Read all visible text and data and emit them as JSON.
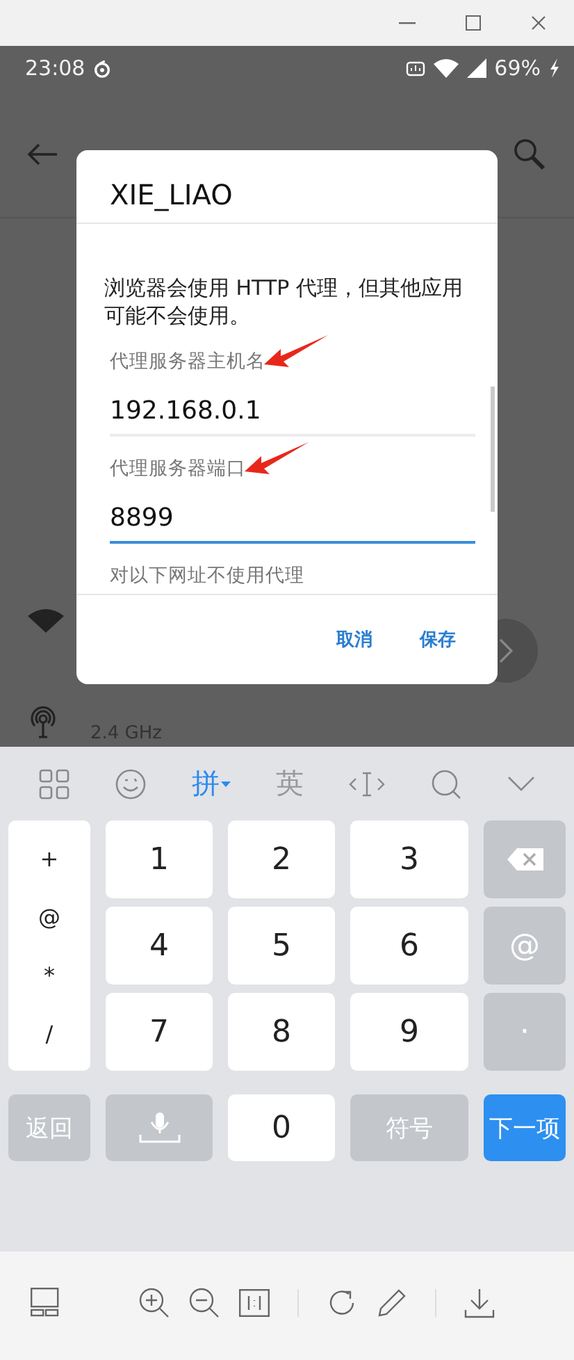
{
  "status_bar": {
    "time": "23:08",
    "battery": "69%"
  },
  "background": {
    "band": "2.4 GHz"
  },
  "dialog": {
    "title": "XIE_LIAO",
    "message": "浏览器会使用 HTTP 代理，但其他应用可能不会使用。",
    "fields": [
      {
        "label": "代理服务器主机名",
        "value": "192.168.0.1",
        "focused": false
      },
      {
        "label": "代理服务器端口",
        "value": "8899",
        "focused": true
      }
    ],
    "hint": "对以下网址不使用代理",
    "buttons": [
      "取消",
      "保存"
    ]
  },
  "keyboard": {
    "toolbar": [
      {
        "kind": "grid"
      },
      {
        "kind": "emoji"
      },
      {
        "kind": "text",
        "label": "拼",
        "selected": true
      },
      {
        "kind": "text",
        "label": "英",
        "selected": false
      },
      {
        "kind": "cursor"
      },
      {
        "kind": "search"
      },
      {
        "kind": "collapse"
      }
    ],
    "symbols": [
      "+",
      "@",
      "*",
      "/"
    ],
    "digits": [
      "1",
      "2",
      "3",
      "4",
      "5",
      "6",
      "7",
      "8",
      "9"
    ],
    "side_keys": [
      {
        "kind": "backspace"
      },
      {
        "kind": "text",
        "label": "@"
      },
      {
        "kind": "text",
        "label": "·"
      }
    ],
    "bottom_keys": [
      {
        "kind": "function",
        "label": "返回"
      },
      {
        "kind": "mic"
      },
      {
        "kind": "digit",
        "label": "0"
      },
      {
        "kind": "function",
        "label": "符号"
      },
      {
        "kind": "action",
        "label": "下一项"
      }
    ]
  }
}
